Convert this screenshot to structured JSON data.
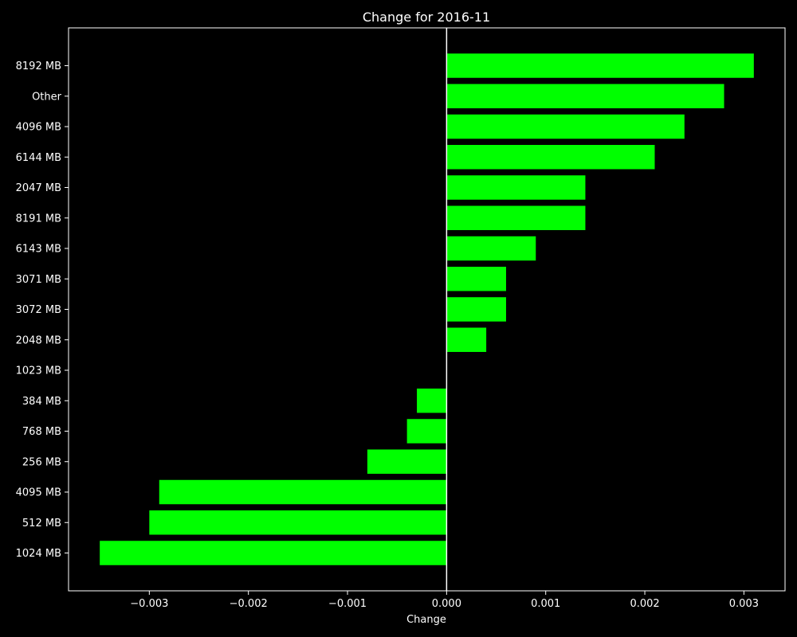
{
  "chart_data": {
    "type": "bar",
    "orientation": "horizontal",
    "title": "Change for 2016-11",
    "xlabel": "Change",
    "ylabel": "",
    "categories": [
      "8192 MB",
      "Other",
      "4096 MB",
      "6144 MB",
      "2047 MB",
      "8191 MB",
      "6143 MB",
      "3071 MB",
      "3072 MB",
      "2048 MB",
      "1023 MB",
      "384 MB",
      "768 MB",
      "256 MB",
      "4095 MB",
      "512 MB",
      "1024 MB"
    ],
    "values": [
      0.0031,
      0.0028,
      0.0024,
      0.0021,
      0.0014,
      0.0014,
      0.0009,
      0.0006,
      0.0006,
      0.0004,
      0.0,
      -0.0003,
      -0.0004,
      -0.0008,
      -0.0029,
      -0.003,
      -0.0035
    ],
    "xlim": [
      -0.003815,
      0.003415
    ],
    "xticks": [
      -0.003,
      -0.002,
      -0.001,
      0.0,
      0.001,
      0.002,
      0.003
    ],
    "xtick_labels": [
      "−0.003",
      "−0.002",
      "−0.001",
      "0.000",
      "0.001",
      "0.002",
      "0.003"
    ],
    "grid": false,
    "legend": "none",
    "bar_color": "#00ff00",
    "background_color": "#000000",
    "zero_line_color": "#ffffff"
  }
}
